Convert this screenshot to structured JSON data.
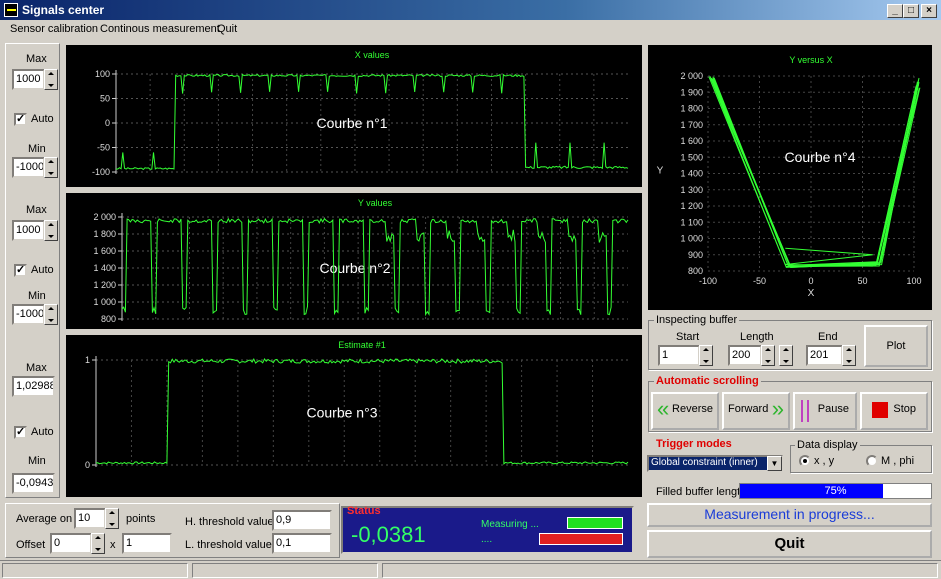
{
  "window": {
    "title": "Signals center",
    "min_label": "_",
    "max_label": "□",
    "close_label": "×"
  },
  "menu": [
    "Sensor calibration",
    "Continous measurement",
    "Quit"
  ],
  "left": {
    "g1": {
      "max_label": "Max",
      "max": "1000",
      "auto_label": "Auto",
      "auto": true,
      "min_label": "Min",
      "min": "-1000"
    },
    "g2": {
      "max_label": "Max",
      "max": "1000",
      "auto_label": "Auto",
      "auto": true,
      "min_label": "Min",
      "min": "-1000"
    },
    "g3": {
      "max_label": "Max",
      "max": "1,02988",
      "auto_label": "Auto",
      "auto": true,
      "min_label": "Min",
      "min": "-0,0943"
    }
  },
  "chart_data": [
    {
      "type": "line",
      "title": "X values",
      "annotation": "Courbe n°1",
      "ylim": [
        -100,
        100
      ],
      "yticks": [
        "100",
        "50",
        "0",
        "-50",
        "-100"
      ],
      "color": "#33ff33"
    },
    {
      "type": "line",
      "title": "Y values",
      "annotation": "Courbe n°2",
      "ylim": [
        800,
        2000
      ],
      "yticks": [
        "2 000",
        "1 800",
        "1 600",
        "1 400",
        "1 200",
        "1 000",
        "800"
      ],
      "color": "#33ff33"
    },
    {
      "type": "line",
      "title": "Estimate #1",
      "annotation": "Courbe n°3",
      "ylim": [
        0,
        1
      ],
      "yticks": [
        "1",
        "0"
      ],
      "color": "#33ff33"
    },
    {
      "type": "scatter",
      "title": "Y versus X",
      "annotation": "Courbe n°4",
      "xlabel": "X",
      "ylabel": "Y",
      "xlim": [
        -100,
        100
      ],
      "ylim": [
        800,
        2000
      ],
      "xticks": [
        "-100",
        "-50",
        "0",
        "50",
        "100"
      ],
      "yticks": [
        "2 000",
        "1 900",
        "1 800",
        "1 700",
        "1 600",
        "1 500",
        "1 400",
        "1 300",
        "1 200",
        "1 100",
        "1 000",
        "900",
        "800"
      ],
      "color": "#33ff33"
    }
  ],
  "inspect": {
    "legend": "Inspecting buffer",
    "start_label": "Start",
    "start": "1",
    "length_label": "Length",
    "length": "200",
    "end_label": "End",
    "end": "201",
    "plot_label": "Plot"
  },
  "scroll": {
    "legend": "Automatic scrolling",
    "reverse_label": "Reverse",
    "forward_label": "Forward",
    "pause_label": "Pause",
    "stop_label": "Stop"
  },
  "trigger": {
    "legend": "Trigger modes",
    "value": "Global constraint (inner)"
  },
  "display": {
    "legend": "Data display",
    "opt1": "x , y",
    "opt2": "M , phi",
    "selected": "x , y"
  },
  "buffer": {
    "label": "Filled buffer length",
    "percent_text": "75%",
    "fraction": 0.75
  },
  "measurement_btn": "Measurement in progress...",
  "quit_btn": "Quit",
  "bottom": {
    "avg_label": "Average on",
    "avg_value": "10",
    "points_label": "points",
    "offset_label": "Offset",
    "offset_value": "0",
    "times": "x",
    "factor_value": "1",
    "hthr_label": "H. threshold value",
    "hthr_value": "0,9",
    "lthr_label": "L. threshold value",
    "lthr_value": "0,1"
  },
  "status": {
    "legend": "Status",
    "value": "-0,0381",
    "measuring_label": "Measuring ...",
    "sub_label": "....",
    "accent": "#1a1a8a"
  }
}
